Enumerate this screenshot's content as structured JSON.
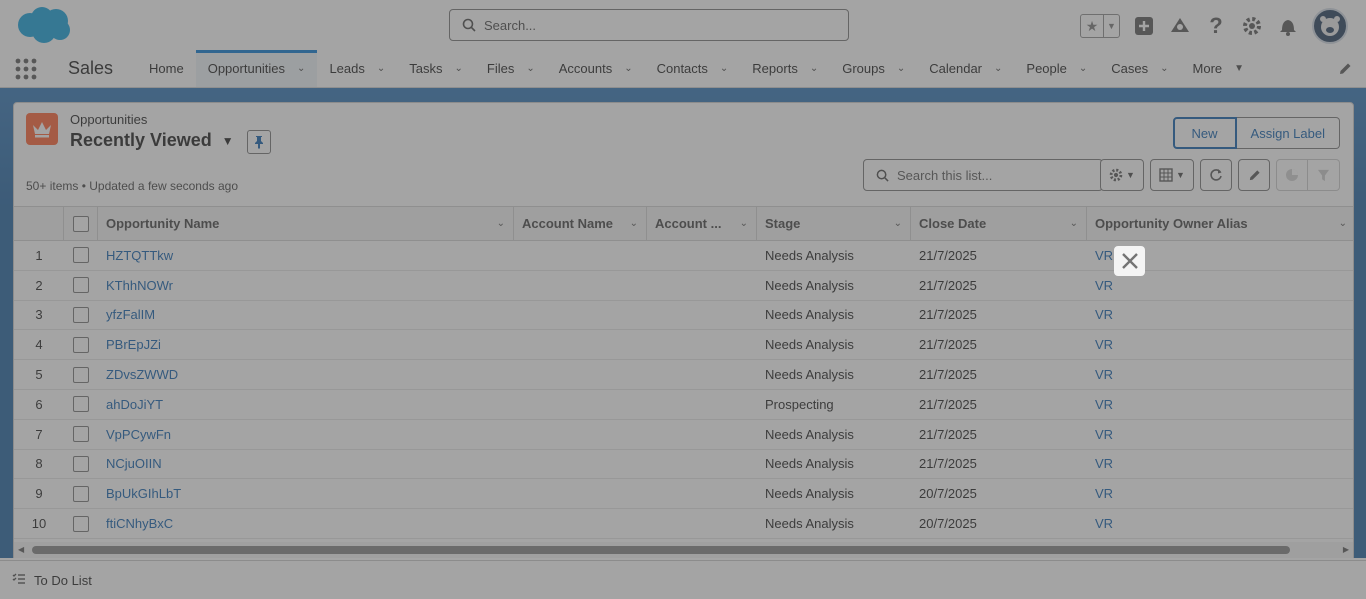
{
  "header": {
    "search_placeholder": "Search..."
  },
  "nav": {
    "app_name": "Sales",
    "items": [
      {
        "label": "Home",
        "dropdown": false,
        "active": false
      },
      {
        "label": "Opportunities",
        "dropdown": true,
        "active": true
      },
      {
        "label": "Leads",
        "dropdown": true,
        "active": false
      },
      {
        "label": "Tasks",
        "dropdown": true,
        "active": false
      },
      {
        "label": "Files",
        "dropdown": true,
        "active": false
      },
      {
        "label": "Accounts",
        "dropdown": true,
        "active": false
      },
      {
        "label": "Contacts",
        "dropdown": true,
        "active": false
      },
      {
        "label": "Reports",
        "dropdown": true,
        "active": false
      },
      {
        "label": "Groups",
        "dropdown": true,
        "active": false
      },
      {
        "label": "Calendar",
        "dropdown": true,
        "active": false
      },
      {
        "label": "People",
        "dropdown": true,
        "active": false
      },
      {
        "label": "Cases",
        "dropdown": true,
        "active": false
      },
      {
        "label": "More",
        "dropdown": true,
        "active": false
      }
    ]
  },
  "listview": {
    "object_label": "Opportunities",
    "title": "Recently Viewed",
    "new_label": "New",
    "assign_label": "Assign Label",
    "meta": "50+ items • Updated a few seconds ago",
    "search_placeholder": "Search this list..."
  },
  "table": {
    "columns": [
      "Opportunity Name",
      "Account Name",
      "Account ...",
      "Stage",
      "Close Date",
      "Opportunity Owner Alias"
    ],
    "rows": [
      {
        "num": "1",
        "name": "HZTQTTkw",
        "account": "",
        "account2": "",
        "stage": "Needs Analysis",
        "close": "21/7/2025",
        "owner": "VR"
      },
      {
        "num": "2",
        "name": "KThhNOWr",
        "account": "",
        "account2": "",
        "stage": "Needs Analysis",
        "close": "21/7/2025",
        "owner": "VR"
      },
      {
        "num": "3",
        "name": "yfzFalIM",
        "account": "",
        "account2": "",
        "stage": "Needs Analysis",
        "close": "21/7/2025",
        "owner": "VR"
      },
      {
        "num": "4",
        "name": "PBrEpJZi",
        "account": "",
        "account2": "",
        "stage": "Needs Analysis",
        "close": "21/7/2025",
        "owner": "VR"
      },
      {
        "num": "5",
        "name": "ZDvsZWWD",
        "account": "",
        "account2": "",
        "stage": "Needs Analysis",
        "close": "21/7/2025",
        "owner": "VR"
      },
      {
        "num": "6",
        "name": "ahDoJiYT",
        "account": "",
        "account2": "",
        "stage": "Prospecting",
        "close": "21/7/2025",
        "owner": "VR"
      },
      {
        "num": "7",
        "name": "VpPCywFn",
        "account": "",
        "account2": "",
        "stage": "Needs Analysis",
        "close": "21/7/2025",
        "owner": "VR"
      },
      {
        "num": "8",
        "name": "NCjuOIIN",
        "account": "",
        "account2": "",
        "stage": "Needs Analysis",
        "close": "21/7/2025",
        "owner": "VR"
      },
      {
        "num": "9",
        "name": "BpUkGIhLbT",
        "account": "",
        "account2": "",
        "stage": "Needs Analysis",
        "close": "20/7/2025",
        "owner": "VR"
      },
      {
        "num": "10",
        "name": "ftiCNhyBxC",
        "account": "",
        "account2": "",
        "stage": "Needs Analysis",
        "close": "20/7/2025",
        "owner": "VR"
      }
    ]
  },
  "utility": {
    "todo_label": "To Do List"
  },
  "colors": {
    "brand": "#0176d3",
    "link": "#0b5cab",
    "object_icon": "#ff5d2d",
    "overlay": "rgba(90,90,90,0.55)"
  }
}
